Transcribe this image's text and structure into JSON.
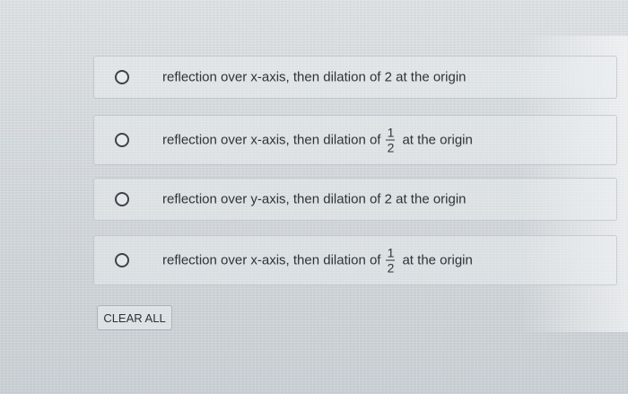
{
  "options": [
    {
      "text": "reflection over x-axis, then dilation of 2 at the origin"
    },
    {
      "before": "reflection over x-axis, then dilation of",
      "frac_num": "1",
      "frac_den": "2",
      "after": "at the origin"
    },
    {
      "text": "reflection over y-axis, then dilation of 2 at the origin"
    },
    {
      "before": "reflection over x-axis, then dilation of",
      "frac_num": "1",
      "frac_den": "2",
      "after": "at the origin"
    }
  ],
  "clear_button": {
    "label": "CLEAR ALL"
  }
}
